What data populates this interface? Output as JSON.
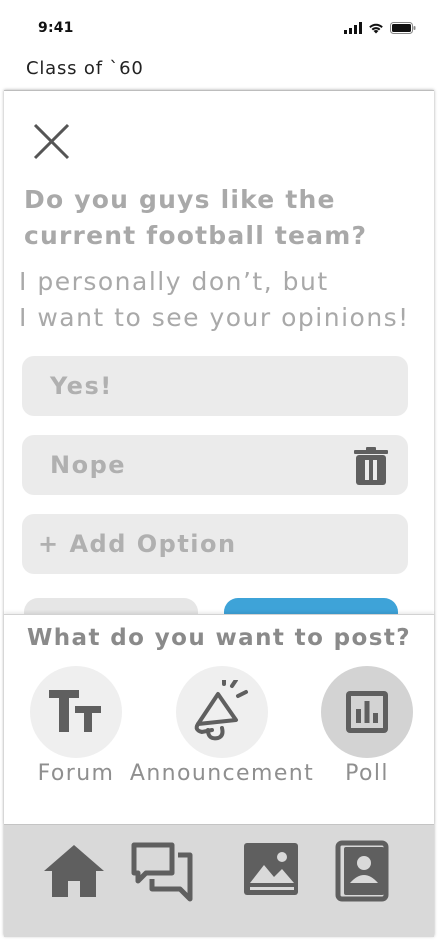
{
  "status_bar": {
    "time": "9:41"
  },
  "header": {
    "title": "Class of `60"
  },
  "poll": {
    "question": "Do you guys like the current football team?",
    "description_line1": "I personally don’t, but",
    "description_line2": "I want to see your opinions!",
    "options": [
      "Yes!",
      "Nope"
    ],
    "add_option_label": "+ Add Option"
  },
  "post_type_sheet": {
    "title": "What do you want to post?",
    "types": [
      {
        "label": "Forum",
        "icon": "text-format-icon",
        "selected": false
      },
      {
        "label": "Announcement",
        "icon": "megaphone-icon",
        "selected": false
      },
      {
        "label": "Poll",
        "icon": "bar-chart-icon",
        "selected": true
      }
    ]
  },
  "tab_bar": {
    "tabs": [
      {
        "icon": "home-icon"
      },
      {
        "icon": "chat-icon"
      },
      {
        "icon": "image-icon"
      },
      {
        "icon": "contact-book-icon"
      }
    ]
  },
  "colors": {
    "question_text": "#a9a9a9",
    "option_bg": "#ebebeb",
    "post_button": "#3ea3d8",
    "selected_type_bg": "#d3d3d3",
    "tab_bar_bg": "#d9d9d9",
    "icon_dark": "#5f5f5f"
  }
}
